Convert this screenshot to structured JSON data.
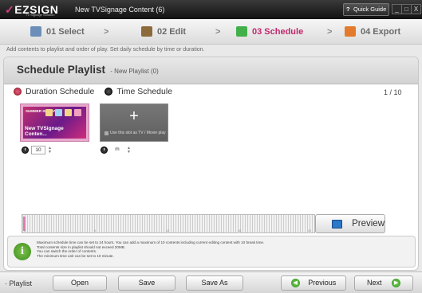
{
  "titlebar": {
    "logo": "EZSIGN",
    "logo_sub": "TV Signage Solution",
    "title": "New TVSignage Content (6)",
    "quick_guide": "Quick Guide",
    "minimize": "_",
    "maximize": "□",
    "close": "X"
  },
  "steps": [
    {
      "label": "01 Select"
    },
    {
      "label": "02 Edit"
    },
    {
      "label": "03 Schedule"
    },
    {
      "label": "04 Export"
    }
  ],
  "step_arrow": ">",
  "hint": "Add contents to playlist and order of play. Set daily schedule by time or duration.",
  "panel": {
    "title": "Schedule Playlist",
    "subtitle": "- New Playlist (0)",
    "duration_schedule": "Duration Schedule",
    "time_schedule": "Time Schedule",
    "page_count": "1 / 10"
  },
  "content_item": {
    "header": "SUMMER SPECIALS",
    "caption": "New TVSignage Conten...",
    "duration": "10"
  },
  "add_item": {
    "label": "Use this slot as TV / Movie play",
    "duration": "m"
  },
  "timeline_ticks": [
    "0",
    "6",
    "12",
    "18",
    "24"
  ],
  "preview_label": "Preview",
  "info_lines": [
    "Maximum schedule time can be set to 24 hours. You can add a maximum of 10 contents including current editing content with 10 break time.",
    "Total contents size in playlist should not exceed 20MB.",
    "You can switch the order of contents.",
    "The minimum time unit can be set to 10 minute."
  ],
  "bottom": {
    "playlist_label": "· Playlist",
    "open": "Open",
    "save": "Save",
    "save_as": "Save As",
    "previous": "Previous",
    "next": "Next"
  },
  "colors": {
    "accent": "#c0286e",
    "green": "#42b04a"
  }
}
